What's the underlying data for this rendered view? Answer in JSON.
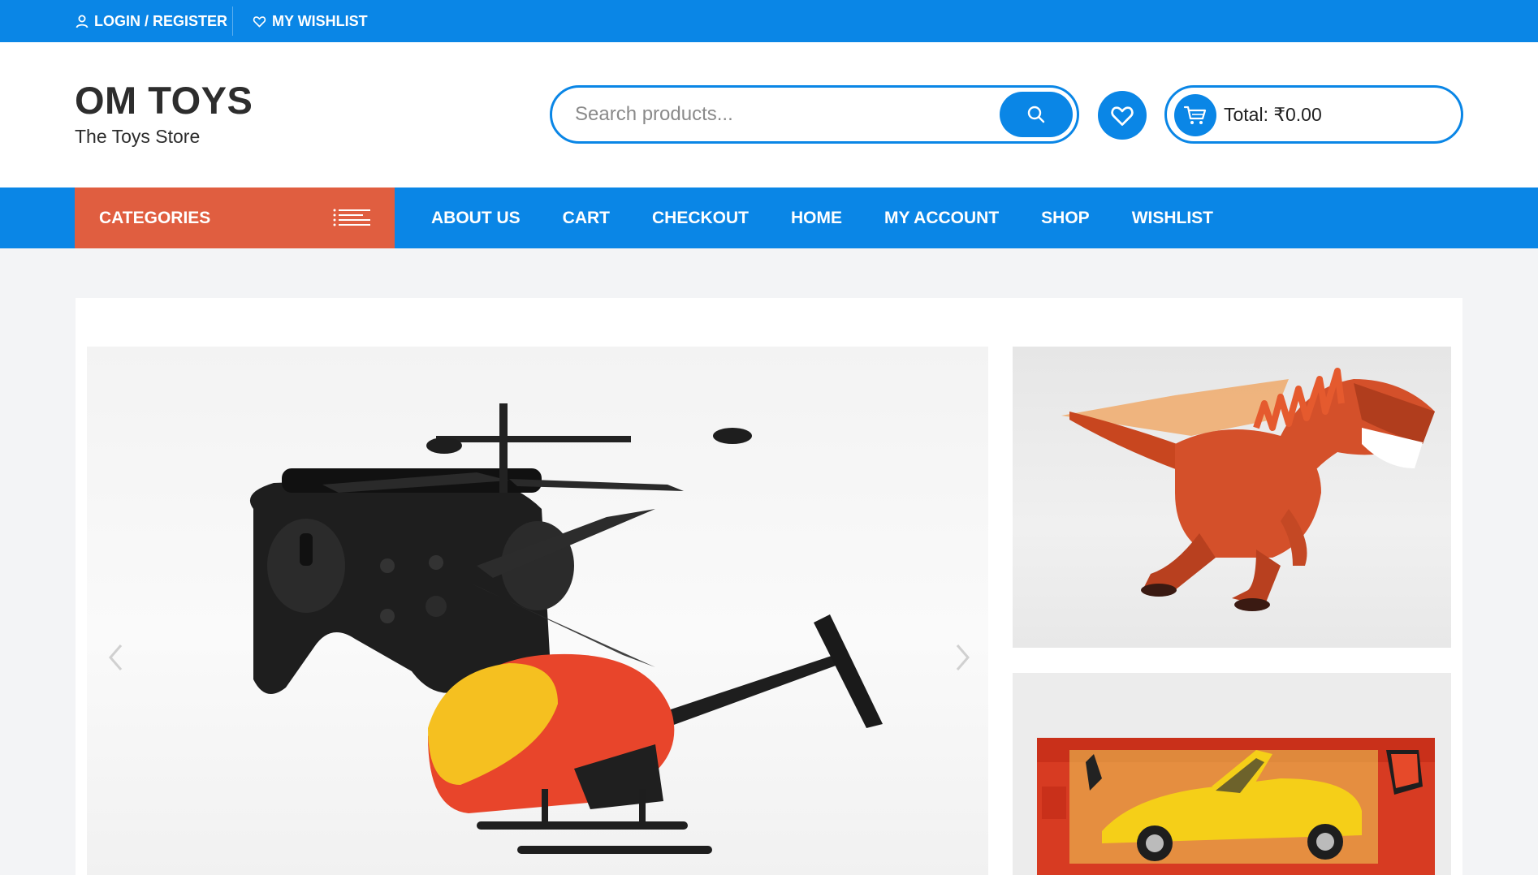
{
  "colors": {
    "primary": "#0a86e6",
    "categories_bg": "#e05e40",
    "page_bg": "#f3f4f6",
    "brand_text": "#2d2d2d"
  },
  "topbar": {
    "login_label": "LOGIN / REGISTER",
    "login_icon": "user-icon",
    "wishlist_label": "MY WISHLIST",
    "wishlist_icon": "heart-outline-icon"
  },
  "header": {
    "site_title": "OM TOYS",
    "tagline": "The Toys Store",
    "search": {
      "placeholder": "Search products...",
      "value": "",
      "button_icon": "search-icon"
    },
    "wishlist_button_icon": "heart-icon",
    "cart": {
      "icon": "cart-icon",
      "total_label": "Total: ₹0.00"
    }
  },
  "nav": {
    "categories_label": "CATEGORIES",
    "categories_icon": "menu-lines-icon",
    "links": [
      "ABOUT US",
      "CART",
      "CHECKOUT",
      "HOME",
      "MY ACCOUNT",
      "SHOP",
      "WISHLIST"
    ]
  },
  "hero": {
    "slider_image": "rc-helicopter-with-remote-photo",
    "prev_icon": "chevron-left-icon",
    "next_icon": "chevron-right-icon",
    "side_images": [
      "dinosaur-toy-photo",
      "rc-sports-car-box-photo"
    ]
  }
}
